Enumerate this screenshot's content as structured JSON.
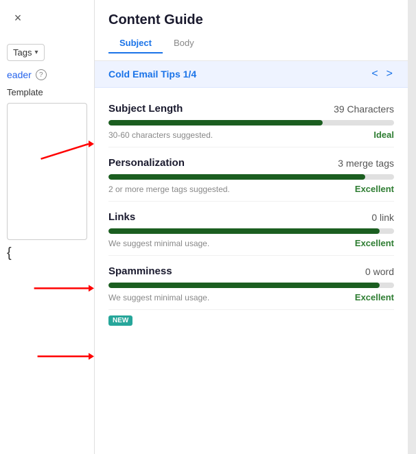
{
  "sidebar": {
    "close_label": "×",
    "tags_label": "Tags",
    "header_label": "eader",
    "template_label": "Template",
    "help_icon": "?",
    "curly_brace": "{"
  },
  "panel": {
    "title": "Content Guide",
    "tabs": [
      {
        "id": "tab1",
        "label": "Subject",
        "active": true
      },
      {
        "id": "tab2",
        "label": "Body",
        "active": false
      }
    ],
    "cold_email": {
      "title": "Cold Email Tips 1/4",
      "prev_label": "<",
      "next_label": ">"
    },
    "metrics": [
      {
        "id": "subject-length",
        "name": "Subject Length",
        "value": "39 Characters",
        "progress": 75,
        "suggestion": "30-60 characters suggested.",
        "status": "Ideal",
        "status_class": "ideal"
      },
      {
        "id": "personalization",
        "name": "Personalization",
        "value": "3 merge tags",
        "progress": 90,
        "suggestion": "2 or more merge tags suggested.",
        "status": "Excellent",
        "status_class": "excellent"
      },
      {
        "id": "links",
        "name": "Links",
        "value": "0 link",
        "progress": 95,
        "suggestion": "We suggest minimal usage.",
        "status": "Excellent",
        "status_class": "excellent"
      },
      {
        "id": "spamminess",
        "name": "Spamminess",
        "value": "0 word",
        "progress": 95,
        "suggestion": "We suggest minimal usage.",
        "status": "Excellent",
        "status_class": "excellent"
      }
    ],
    "new_badge_label": "NEW"
  }
}
